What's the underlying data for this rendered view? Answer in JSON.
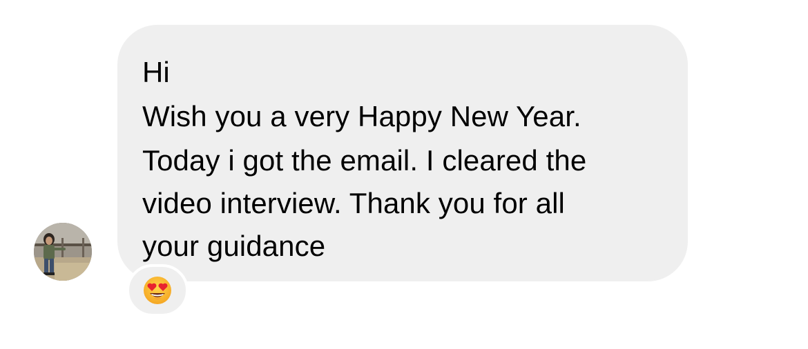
{
  "conversation": {
    "sender_avatar_icon": "profile-photo-person-outdoors",
    "message": {
      "lines": [
        "Hi",
        "Wish you a very Happy New Year.",
        "Today i got the email. I cleared the",
        "video interview. Thank you for all",
        "your guidance"
      ],
      "bubble_color": "#efefef",
      "text_color": "#000000"
    },
    "reaction": {
      "icon": "heart-eyes-emoji-icon"
    }
  }
}
